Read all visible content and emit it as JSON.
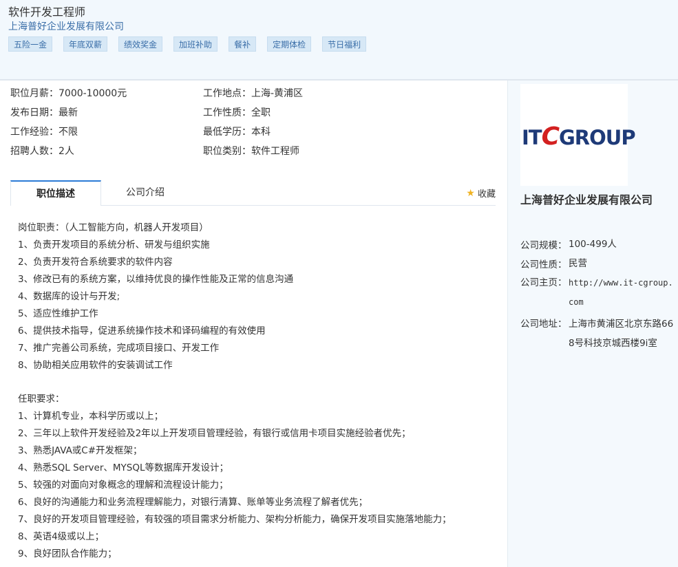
{
  "job": {
    "title": "软件开发工程师",
    "company": "上海普好企业发展有限公司",
    "tags": [
      "五险一金",
      "年底双薪",
      "绩效奖金",
      "加班补助",
      "餐补",
      "定期体检",
      "节日福利"
    ]
  },
  "info": {
    "salary": "职位月薪：7000-10000元",
    "location": "工作地点：上海-黄浦区",
    "date": "发布日期：最新",
    "nature": "工作性质：全职",
    "experience": "工作经验：不限",
    "education": "最低学历：本科",
    "headcount": "招聘人数：2人",
    "category": "职位类别：软件工程师"
  },
  "tabs": {
    "active": "职位描述",
    "other": "公司介绍",
    "favorite": "收藏"
  },
  "description": {
    "duties": [
      "岗位职责：（人工智能方向，机器人开发项目）",
      "1、负责开发项目的系统分析、研发与组织实施",
      "2、负责开发符合系统要求的软件内容",
      "3、修改已有的系统方案，以维持优良的操作性能及正常的信息沟通",
      "4、数据库的设计与开发;",
      "5、适应性维护工作",
      "6、提供技术指导，促进系统操作技术和译码编程的有效使用",
      "7、推广完善公司系统，完成项目接口、开发工作",
      "8、协助相关应用软件的安装调试工作"
    ],
    "requirements": [
      "任职要求：",
      "1、计算机专业，本科学历或以上；",
      "2、三年以上软件开发经验及2年以上开发项目管理经验，有银行或信用卡项目实施经验者优先；",
      "3、熟悉JAVA或C#开发框架；",
      "4、熟悉SQL Server、MYSQL等数据库开发设计；",
      "5、较强的对面向对象概念的理解和流程设计能力；",
      "6、良好的沟通能力和业务流程理解能力，对银行清算、账单等业务流程了解者优先；",
      "7、良好的开发项目管理经验，有较强的项目需求分析能力、架构分析能力，确保开发项目实施落地能力；",
      "8、英语4级或以上；",
      "9、良好团队合作能力；"
    ]
  },
  "sidebar": {
    "logo_text_1": "IT",
    "logo_text_2": "C",
    "logo_text_3": "GROUP",
    "company": "上海普好企业发展有限公司",
    "scale_label": "公司规模：",
    "scale": "100-499人",
    "type_label": "公司性质：",
    "type": "民营",
    "homepage_label": "公司主页：",
    "homepage": "http://www.it-cgroup.com",
    "address_label": "公司地址：",
    "address": "上海市黄浦区北京东路668号科技京城西楼9i室"
  }
}
